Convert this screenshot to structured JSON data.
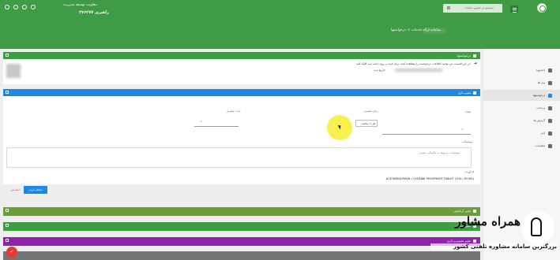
{
  "header": {
    "org_line1": "معاونت توسعه مدیریت",
    "org_line2": "۲۷۶۲۷۷ راهبری",
    "search_placeholder": "جستجو در عناوین سامانه",
    "page_title": "سامانه ارائه خدمات > درخواستها",
    "colors": {
      "bar": "#3f9b46"
    }
  },
  "sidebar": {
    "items": [
      {
        "label": "داشبورد",
        "icon": "home-icon"
      },
      {
        "label": "پیام ها",
        "icon": "mail-icon"
      },
      {
        "label": "درخواستها",
        "icon": "users-icon",
        "active": true
      },
      {
        "label": "پرداخت",
        "icon": "basket-icon"
      },
      {
        "label": "گزارش ها",
        "icon": "report-icon"
      },
      {
        "label": "آمار",
        "icon": "chart-icon"
      },
      {
        "label": "تنظیمات",
        "icon": "settings-icon"
      }
    ]
  },
  "panels": {
    "requests": {
      "title": "درخواستها",
      "color": "#3f9b46"
    },
    "info": {
      "line1": "در این قسمت می توانید اطلاعات درخواست را مشاهده کنید. برای تایید بر روی دکمه ثبت کلیک کنید.",
      "line2": "تاریخ ثبت:"
    },
    "edit": {
      "title": "تغییر دارو",
      "color": "#1e88e5"
    },
    "collapsed": [
      {
        "title": "تغییر آزمایش",
        "color": "#689f38"
      },
      {
        "title": "تغییر خدمات",
        "color": "#3f9b46"
      },
      {
        "title": "تغییر تصویربرداری",
        "color": "#8e24aa"
      }
    ]
  },
  "form": {
    "count_label": "تعداد",
    "count_value": "۱",
    "usage_label": "زمان مصرف",
    "usage_value": "هر ۸ ساعت",
    "duration_label": "مدت مصرف",
    "duration_value": "۱",
    "description_label": "توضیحات",
    "description_placeholder": "توضیحات مربوط به چگونگی مصرف",
    "product_label": "فرآورده",
    "product_value": "ACETAMINOPHEN / CODEINE PHOSPHATE TABLET (300 / 30 MG)",
    "submit_label": "اضافه کردن",
    "cancel_label": "انصراف"
  },
  "watermark": {
    "brand": "همراه مشاور",
    "tagline": "بزرگترین سامانه مشاوره تلفنی کشور"
  }
}
